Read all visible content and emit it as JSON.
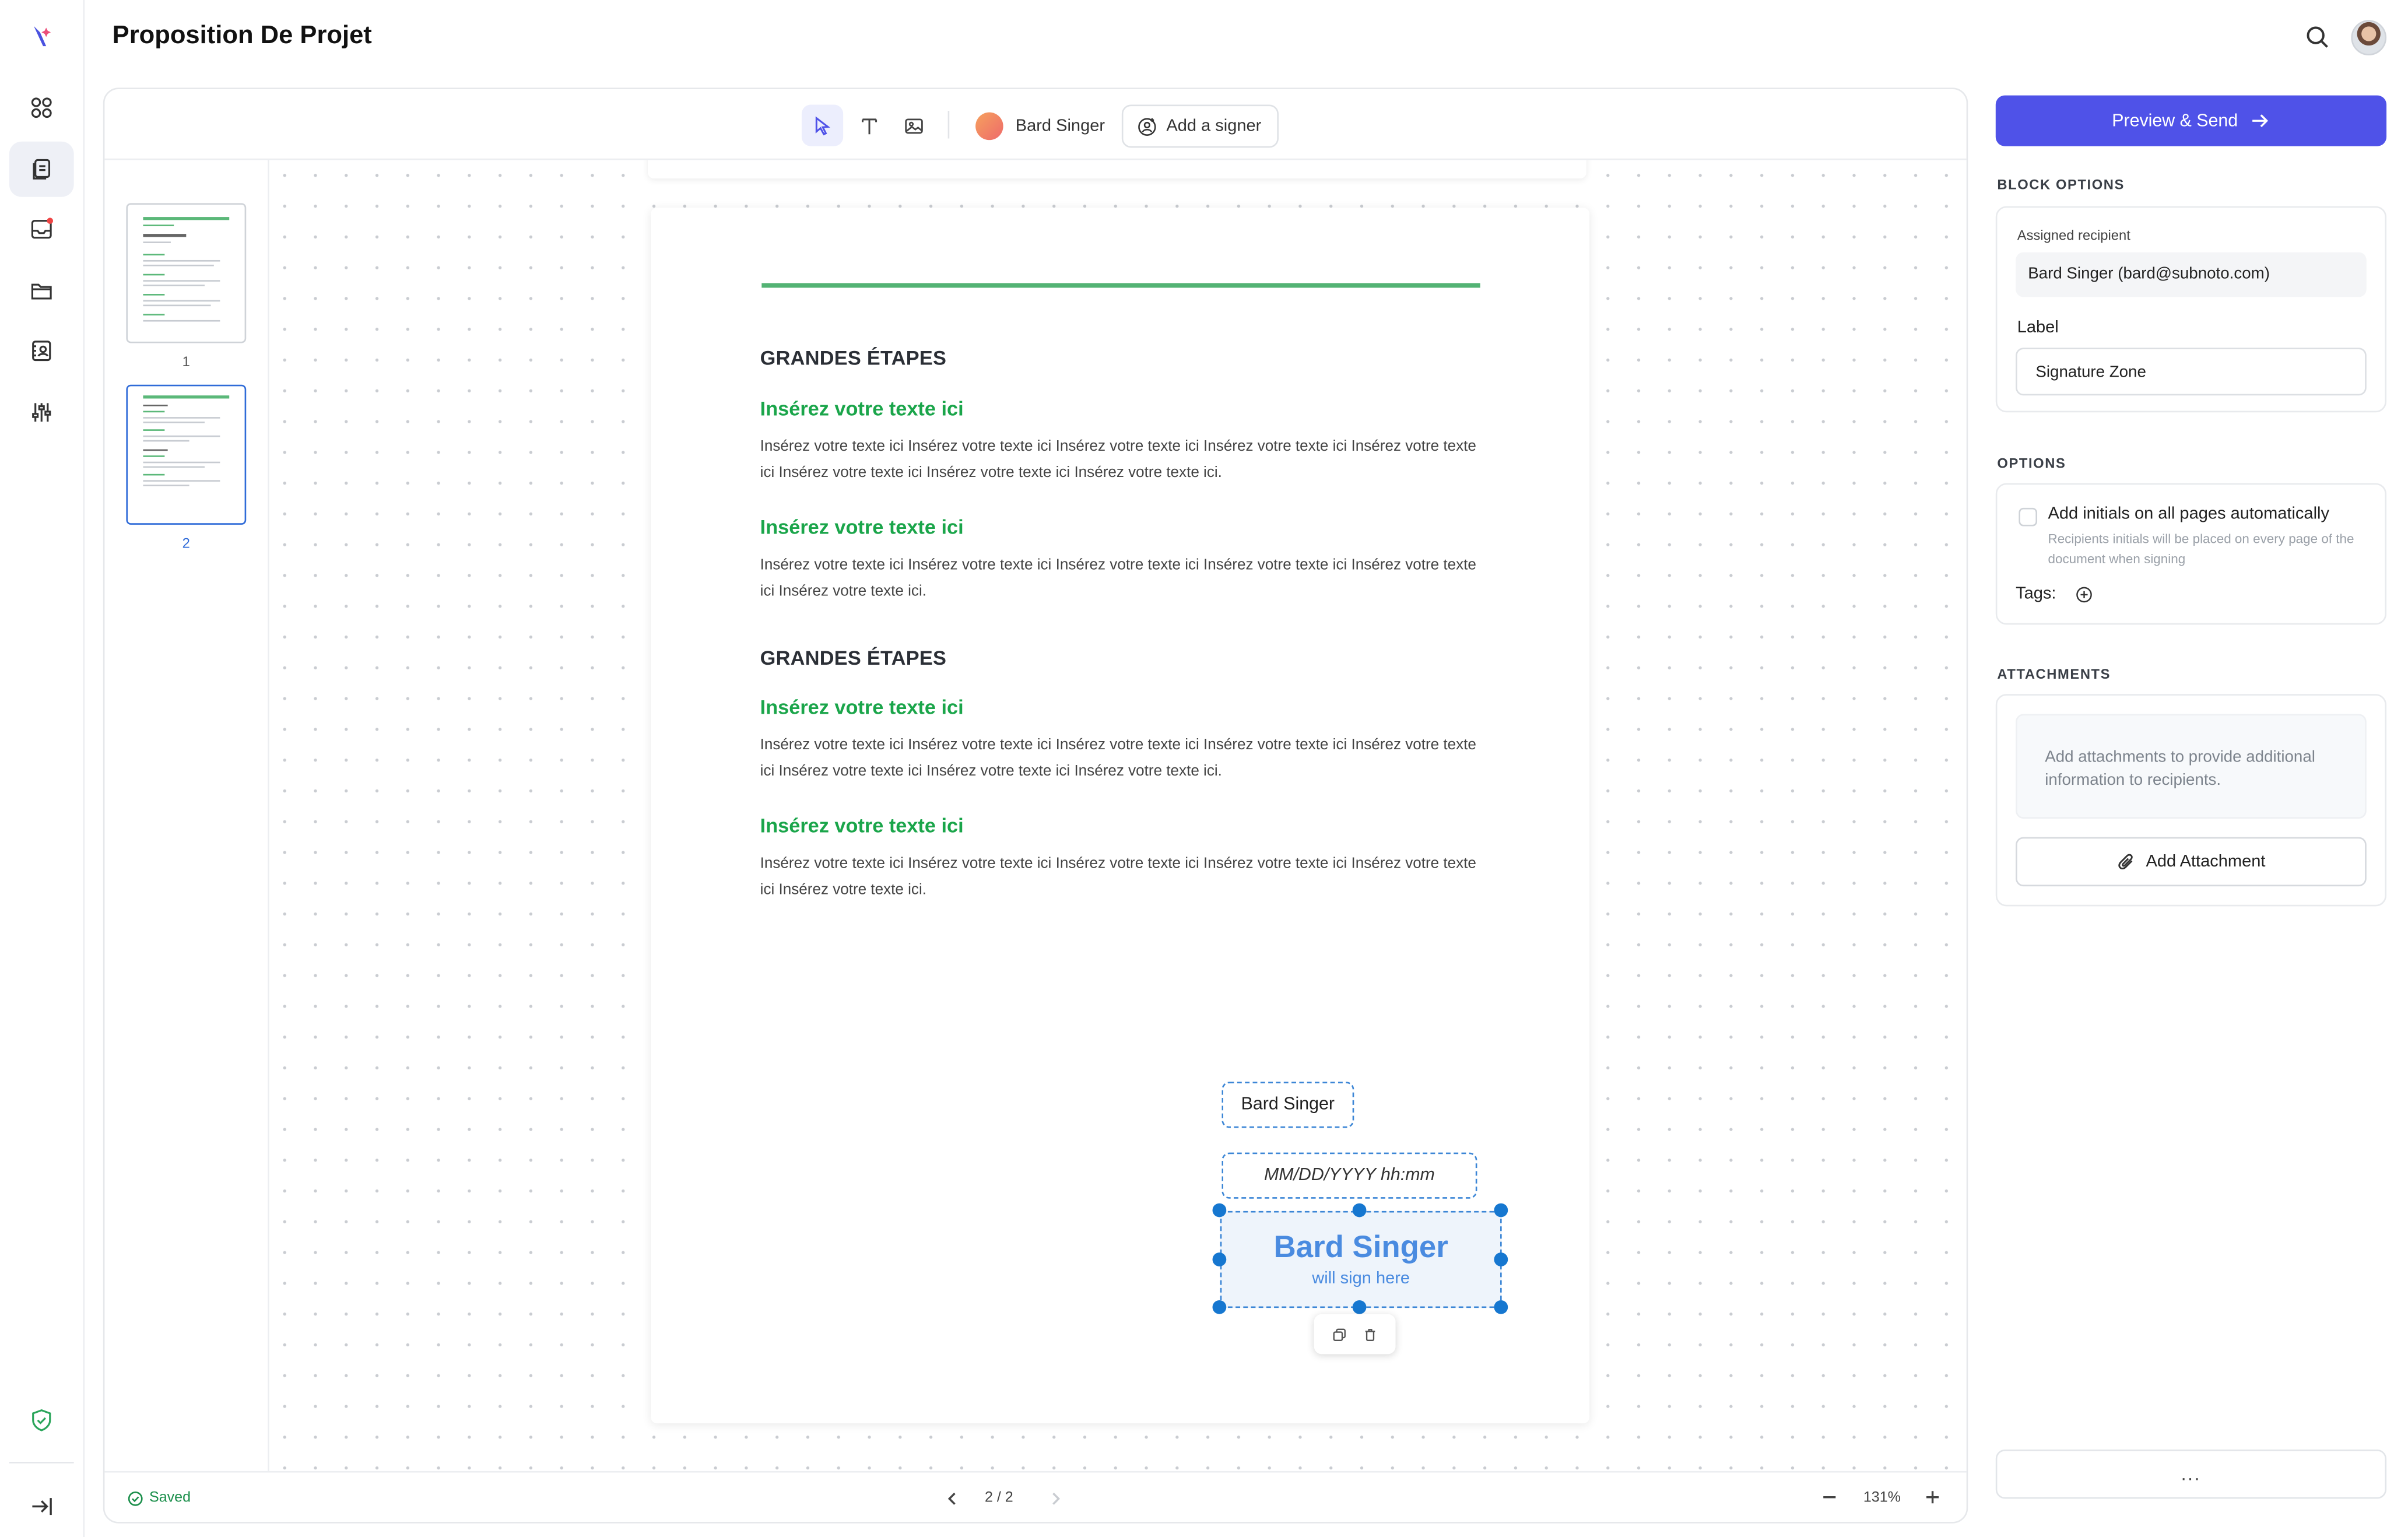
{
  "app": {
    "title": "Proposition De Projet"
  },
  "nav": {
    "items": [
      {
        "name": "nav-logo",
        "icon": "feather-logo-icon"
      },
      {
        "name": "nav-dashboard",
        "icon": "grid-icon"
      },
      {
        "name": "nav-documents",
        "icon": "documents-icon",
        "active": true
      },
      {
        "name": "nav-inbox",
        "icon": "inbox-icon",
        "badge": true
      },
      {
        "name": "nav-folders",
        "icon": "folder-icon"
      },
      {
        "name": "nav-contacts",
        "icon": "contact-card-icon"
      },
      {
        "name": "nav-settings",
        "icon": "sliders-icon"
      },
      {
        "name": "nav-security",
        "icon": "shield-check-icon"
      },
      {
        "name": "nav-collapse",
        "icon": "collapse-sidebar-icon"
      }
    ]
  },
  "toolbar": {
    "tools": [
      "select-tool",
      "text-tool",
      "image-tool"
    ],
    "signer_name": "Bard Singer",
    "add_signer_label": "Add a signer"
  },
  "thumbnails": [
    {
      "page": "1"
    },
    {
      "page": "2",
      "active": true
    }
  ],
  "document": {
    "section1_title": "GRANDES ÉTAPES",
    "section2_title": "GRANDES ÉTAPES",
    "blocks": [
      {
        "heading": "Insérez votre texte ici",
        "text": "Insérez votre texte ici Insérez votre texte ici Insérez votre texte ici Insérez votre texte ici Insérez votre texte ici Insérez votre texte ici Insérez votre texte ici Insérez votre texte ici."
      },
      {
        "heading": "Insérez votre texte ici",
        "text": "Insérez votre texte ici Insérez votre texte ici Insérez votre texte ici Insérez votre texte ici Insérez votre texte ici Insérez votre texte ici."
      },
      {
        "heading": "Insérez votre texte ici",
        "text": "Insérez votre texte ici Insérez votre texte ici Insérez votre texte ici Insérez votre texte ici Insérez votre texte ici Insérez votre texte ici Insérez votre texte ici Insérez votre texte ici."
      },
      {
        "heading": "Insérez votre texte ici",
        "text": "Insérez votre texte ici Insérez votre texte ici Insérez votre texte ici Insérez votre texte ici Insérez votre texte ici Insérez votre texte ici."
      }
    ],
    "fields": {
      "name_field": "Bard Singer",
      "date_field": "MM/DD/YYYY hh:mm",
      "signature_name": "Bard Singer",
      "signature_sub": "will sign here"
    }
  },
  "status": {
    "saved_label": "Saved",
    "page_indicator": "2 / 2",
    "zoom": "131%"
  },
  "right_panel": {
    "send_label": "Preview & Send",
    "block_options_title": "BLOCK OPTIONS",
    "assigned_recipient_label": "Assigned recipient",
    "assigned_recipient_value": "Bard Singer (bard@subnoto.com)",
    "label_label": "Label",
    "label_value": "Signature Zone",
    "options_title": "OPTIONS",
    "initials_option": "Add initials on all pages automatically",
    "initials_desc": "Recipients initials will be placed on every page of the document when signing",
    "tags_label": "Tags:",
    "attachments_title": "ATTACHMENTS",
    "attachments_note": "Add attachments to provide additional information to recipients.",
    "add_attachment_label": "Add Attachment",
    "more_label": "..."
  },
  "colors": {
    "accent": "#4f52e8",
    "heading_green": "#1aa54a",
    "rule_green": "#53b374",
    "field_blue": "#3c86d6",
    "saved_green": "#1b8f4b"
  }
}
